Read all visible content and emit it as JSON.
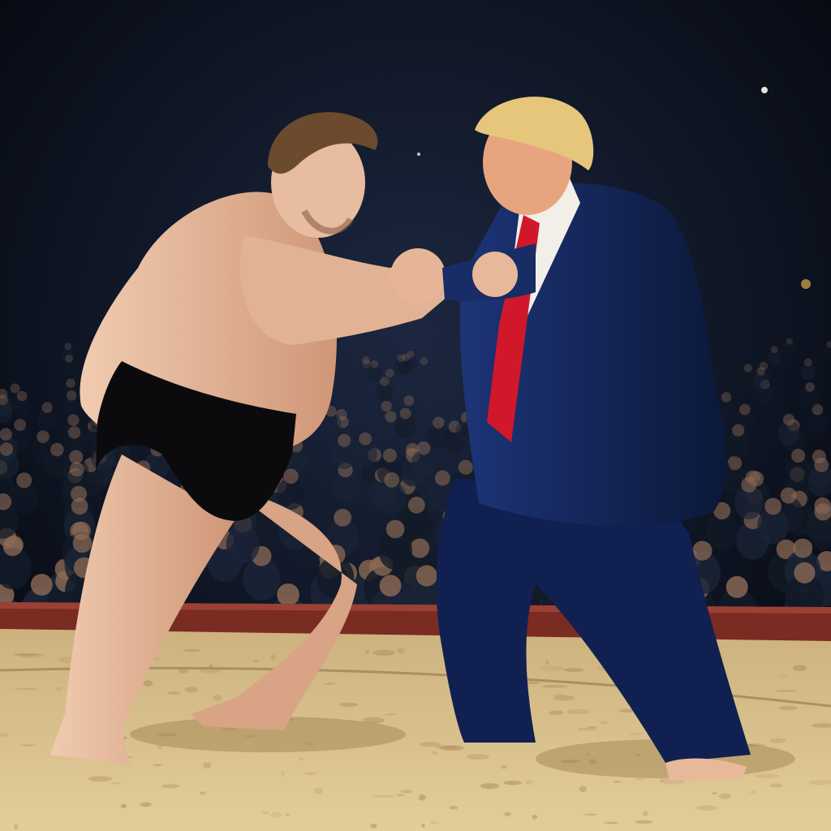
{
  "scene": {
    "colors": {
      "arena_dark": "#05080f",
      "crowd_shadow": "#121a27",
      "crowd_suit": "#1a2436",
      "crowd_skin": "#8c6a55",
      "ring_edge": "#7a2b22",
      "sand_light": "#d9c38f",
      "sand_dark": "#b09060",
      "wrestler_skin": "#e8bca0",
      "wrestler_skin_shadow": "#c98f70",
      "mawashi": "#0b0b0d",
      "suit_navy": "#14265a",
      "suit_shadow": "#0a1636",
      "shirt": "#f2efe9",
      "tie_red": "#d1182b",
      "hair_brown": "#6b4a2e",
      "hair_blond": "#e6c67a",
      "spot_light": "#e8e6d8"
    }
  }
}
